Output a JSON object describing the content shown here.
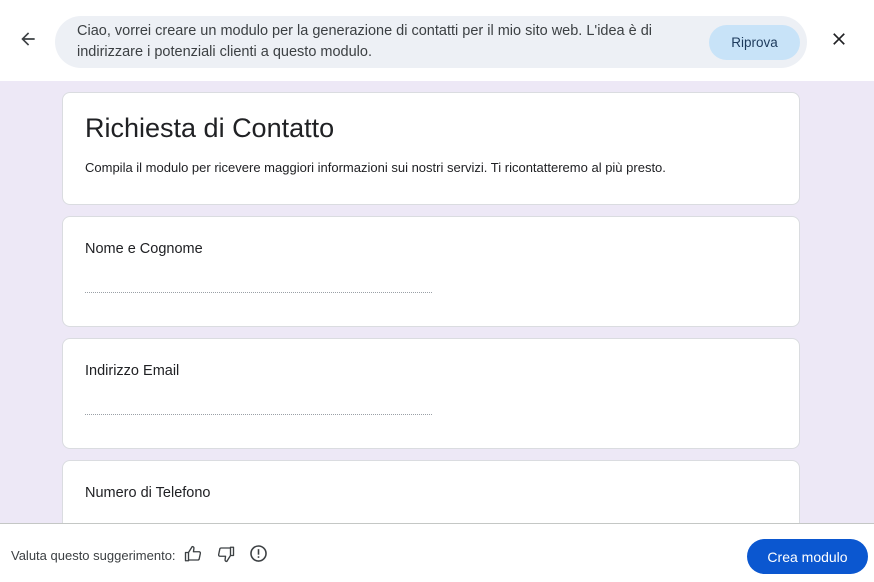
{
  "header": {
    "prompt_text": "Ciao, vorrei creare un modulo per la generazione di contatti per il mio sito web. L'idea è di indirizzare i potenziali clienti a questo modulo.",
    "retry_label": "Riprova",
    "icons": {
      "back": "arrow-left-icon",
      "close": "close-icon"
    }
  },
  "form": {
    "title": "Richiesta di Contatto",
    "description": "Compila il modulo per ricevere maggiori informazioni sui nostri servizi. Ti ricontatteremo al più presto.",
    "questions": [
      {
        "label": "Nome e Cognome"
      },
      {
        "label": "Indirizzo Email"
      },
      {
        "label": "Numero di Telefono"
      }
    ]
  },
  "footer": {
    "rate_label": "Valuta questo suggerimento:",
    "icons": [
      "thumbs-up-icon",
      "thumbs-down-icon",
      "report-icon"
    ],
    "create_label": "Crea modulo"
  },
  "colors": {
    "canvas_bg": "#ede8f6",
    "pill_bg": "#edf0f5",
    "retry_bg": "#c8e3f8",
    "primary": "#0b57d0"
  }
}
